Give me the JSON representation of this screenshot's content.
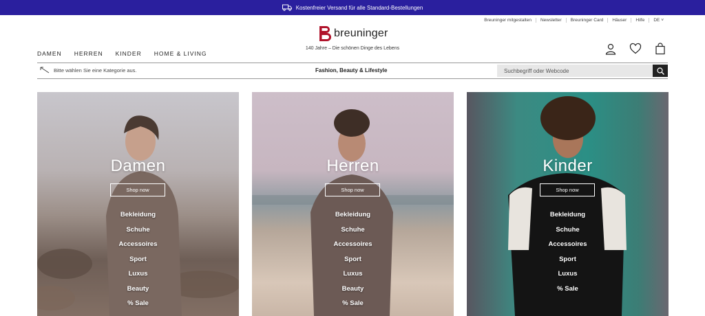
{
  "topbar": {
    "shipping_text": "Kostenfreier Versand für alle Standard-Bestellungen"
  },
  "utility_links": [
    "Breuninger mitgestalten",
    "Newsletter",
    "Breuninger Card",
    "Häuser",
    "Hilfe",
    "DE"
  ],
  "logo": {
    "wordmark": "breuninger",
    "tagline": "140 Jahre – Die schönen Dinge des Lebens"
  },
  "main_nav": [
    "DAMEN",
    "HERREN",
    "KINDER",
    "HOME & LIVING"
  ],
  "category_bar": {
    "hint": "Bitte wählen Sie eine Kategorie aus.",
    "center": "Fashion, Beauty & Lifestyle",
    "search_placeholder": "Suchbegriff oder Webcode"
  },
  "cards": [
    {
      "title": "Damen",
      "shop_label": "Shop now",
      "links": [
        "Bekleidung",
        "Schuhe",
        "Accessoires",
        "Sport",
        "Luxus",
        "Beauty",
        "% Sale"
      ]
    },
    {
      "title": "Herren",
      "shop_label": "Shop now",
      "links": [
        "Bekleidung",
        "Schuhe",
        "Accessoires",
        "Sport",
        "Luxus",
        "Beauty",
        "% Sale"
      ]
    },
    {
      "title": "Kinder",
      "shop_label": "Shop now",
      "links": [
        "Bekleidung",
        "Schuhe",
        "Accessoires",
        "Sport",
        "Luxus",
        "% Sale"
      ]
    }
  ],
  "colors": {
    "topbar_bg": "#2a1f9e",
    "brand_red": "#b0132b",
    "search_bg": "#e7e7e7"
  },
  "icons": [
    "truck-icon",
    "account-icon",
    "wishlist-heart-icon",
    "shopping-bag-icon",
    "search-icon",
    "chevron-down-icon",
    "back-arrow-icon"
  ]
}
